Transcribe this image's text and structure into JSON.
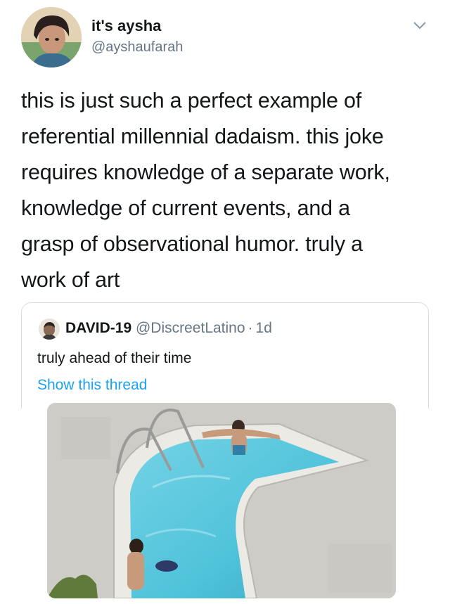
{
  "author": {
    "name": "it's aysha",
    "handle": "@ayshaufarah"
  },
  "tweet": {
    "lines": [
      "this is just such a perfect example of",
      "referential millennial dadaism. this joke",
      "requires knowledge of a separate work,",
      "knowledge of current events, and a",
      "grasp of observational humor. truly a",
      "work of art"
    ]
  },
  "quoted": {
    "name": "DAVID-19",
    "handle": "@DiscreetLatino",
    "separator": "·",
    "time": "1d",
    "text": "truly ahead of their time",
    "link": "Show this thread"
  },
  "colors": {
    "link": "#1da1f2",
    "secondary": "#657786",
    "water": "#4fc3da"
  },
  "icons": {
    "menu": "chevron-down-icon"
  }
}
